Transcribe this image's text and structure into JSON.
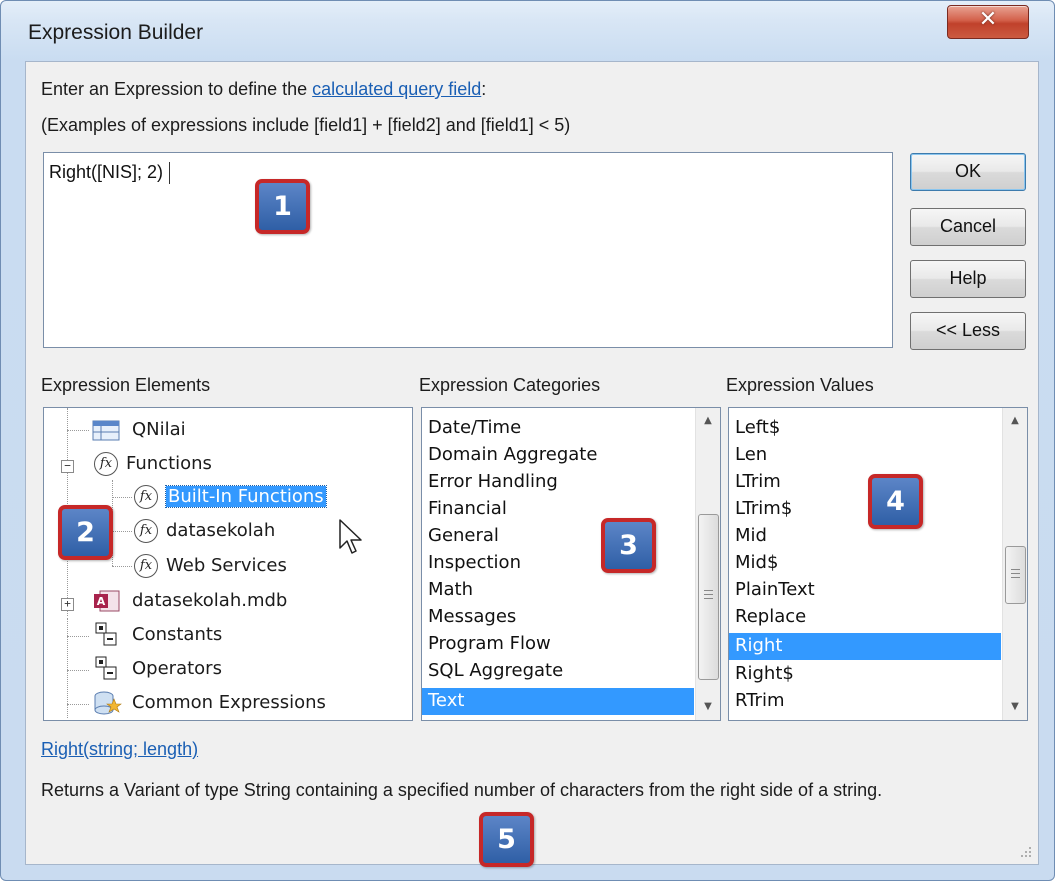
{
  "window": {
    "title": "Expression Builder",
    "close_glyph": "✕"
  },
  "intro": {
    "line1_prefix": "Enter an Expression to define the ",
    "line1_link": "calculated query field",
    "line1_suffix": ":",
    "line2": "(Examples of expressions include [field1] + [field2] and [field1] < 5)"
  },
  "expression": {
    "value": "Right([NIS]; 2)"
  },
  "buttons": {
    "ok": "OK",
    "cancel": "Cancel",
    "help": "Help",
    "less": "<< Less"
  },
  "headings": {
    "elements": "Expression Elements",
    "categories": "Expression Categories",
    "values": "Expression Values"
  },
  "elements_tree": [
    {
      "label": "QNilai",
      "icon": "query-icon"
    },
    {
      "label": "Functions",
      "icon": "function-icon",
      "expander": "-"
    },
    {
      "label": "Built-In Functions",
      "icon": "function-icon",
      "selected": true
    },
    {
      "label": "datasekolah",
      "icon": "function-icon"
    },
    {
      "label": "Web Services",
      "icon": "function-icon"
    },
    {
      "label": "datasekolah.mdb",
      "icon": "access-database-icon",
      "expander": "+"
    },
    {
      "label": "Constants",
      "icon": "constants-icon"
    },
    {
      "label": "Operators",
      "icon": "operators-icon"
    },
    {
      "label": "Common Expressions",
      "icon": "common-expressions-icon"
    }
  ],
  "categories": [
    "Date/Time",
    "Domain Aggregate",
    "Error Handling",
    "Financial",
    "General",
    "Inspection",
    "Math",
    "Messages",
    "Program Flow",
    "SQL Aggregate",
    "Text"
  ],
  "categories_selected": "Text",
  "values": [
    "Left$",
    "Len",
    "LTrim",
    "LTrim$",
    "Mid",
    "Mid$",
    "PlainText",
    "Replace",
    "Right",
    "Right$",
    "RTrim"
  ],
  "values_selected": "Right",
  "function_signature": "Right(string; length)",
  "description": "Returns a Variant of type String containing a specified number of characters from the right side of a string.",
  "callouts": [
    "1",
    "2",
    "3",
    "4",
    "5"
  ],
  "colors": {
    "selection": "#3399ff",
    "link": "#1a5fb4",
    "callout_border": "#c62828",
    "callout_fill": "#2f5fa6"
  }
}
